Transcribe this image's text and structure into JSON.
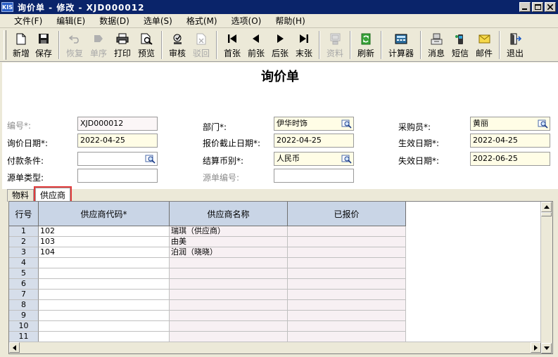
{
  "window": {
    "logo": "KIS",
    "title": "询价单 - 修改 - XJD000012"
  },
  "menu": [
    "文件(F)",
    "编辑(E)",
    "数据(D)",
    "选单(S)",
    "格式(M)",
    "选项(O)",
    "帮助(H)"
  ],
  "toolbar": {
    "new": "新增",
    "save": "保存",
    "restore": "恢复",
    "order": "单序",
    "print": "打印",
    "preview": "预览",
    "audit": "审核",
    "reject": "驳回",
    "first": "首张",
    "prev": "前张",
    "next": "后张",
    "last": "末张",
    "material": "资料",
    "refresh": "刷新",
    "calculator": "计算器",
    "message": "消息",
    "sms": "短信",
    "mail": "邮件",
    "exit": "退出"
  },
  "form": {
    "title": "询价单",
    "labels": {
      "number": "编号*:",
      "inquiry_date": "询价日期*:",
      "payment": "付款条件:",
      "source_type": "源单类型:",
      "department": "部门*:",
      "quote_deadline": "报价截止日期*:",
      "currency": "结算币别*:",
      "source_number": "源单编号:",
      "buyer": "采购员*:",
      "effective_date": "生效日期*:",
      "expiry_date": "失效日期*:"
    },
    "values": {
      "number": "XJD000012",
      "inquiry_date": "2022-04-25",
      "payment": "",
      "source_type": "",
      "department": "伊华时饰",
      "quote_deadline": "2022-04-25",
      "currency": "人民币",
      "source_number": "",
      "buyer": "黄丽",
      "effective_date": "2022-04-25",
      "expiry_date": "2022-06-25"
    }
  },
  "tabs": [
    "物料",
    "供应商"
  ],
  "grid": {
    "headers": [
      "行号",
      "供应商代码*",
      "供应商名称",
      "已报价"
    ],
    "rows": [
      {
        "n": "1",
        "code": "102",
        "name": "瑞琪（供应商）",
        "quoted": ""
      },
      {
        "n": "2",
        "code": "103",
        "name": "由美",
        "quoted": ""
      },
      {
        "n": "3",
        "code": "104",
        "name": "泊润（晓晓）",
        "quoted": ""
      },
      {
        "n": "4",
        "code": "",
        "name": "",
        "quoted": ""
      },
      {
        "n": "5",
        "code": "",
        "name": "",
        "quoted": ""
      },
      {
        "n": "6",
        "code": "",
        "name": "",
        "quoted": ""
      },
      {
        "n": "7",
        "code": "",
        "name": "",
        "quoted": ""
      },
      {
        "n": "8",
        "code": "",
        "name": "",
        "quoted": ""
      },
      {
        "n": "9",
        "code": "",
        "name": "",
        "quoted": ""
      },
      {
        "n": "10",
        "code": "",
        "name": "",
        "quoted": ""
      },
      {
        "n": "11",
        "code": "",
        "name": "",
        "quoted": ""
      }
    ]
  },
  "colors": {
    "titlebar": "#0a246a",
    "grid_header": "#c9d5e6",
    "highlight": "#e23b3b",
    "required_field": "#fffde6"
  }
}
